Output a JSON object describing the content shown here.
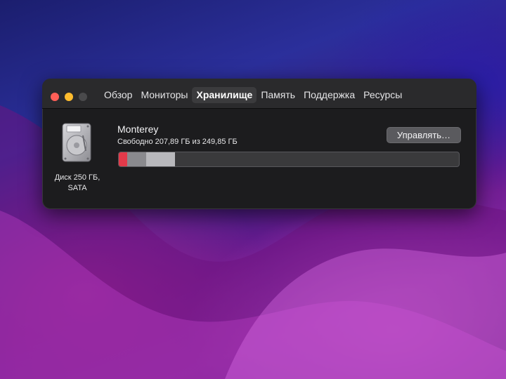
{
  "window": {
    "tabs": [
      {
        "label": "Обзор",
        "active": false
      },
      {
        "label": "Мониторы",
        "active": false
      },
      {
        "label": "Хранилище",
        "active": true
      },
      {
        "label": "Память",
        "active": false
      },
      {
        "label": "Поддержка",
        "active": false
      },
      {
        "label": "Ресурсы",
        "active": false
      }
    ]
  },
  "disk": {
    "label_line1": "Диск 250 ГБ,",
    "label_line2": "SATA"
  },
  "volume": {
    "name": "Monterey",
    "free_text": "Свободно 207,89 ГБ из 249,85 ГБ",
    "manage_label": "Управлять…",
    "usage_segments": [
      {
        "name": "system",
        "color": "#e23a4a",
        "fraction": 0.025
      },
      {
        "name": "apps",
        "color": "#8a8a8e",
        "fraction": 0.055
      },
      {
        "name": "other",
        "color": "#b8b8bc",
        "fraction": 0.085
      }
    ]
  },
  "colors": {
    "window_bg": "#1c1c1e",
    "bar_free": "#3a3a3c"
  }
}
